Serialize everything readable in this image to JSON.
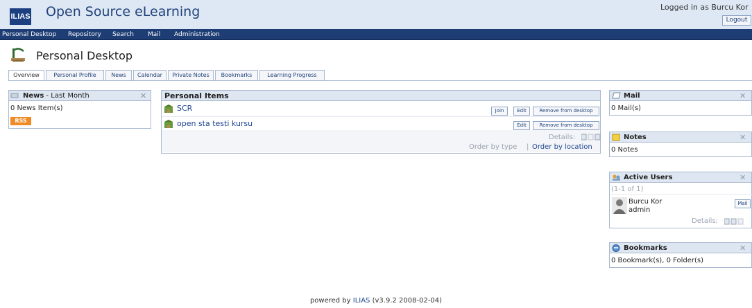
{
  "header": {
    "logo_text": "ILIAS",
    "app_title": "Open Source eLearning",
    "login_text": "Logged in as Burcu Kor",
    "logout_label": "Logout"
  },
  "mainmenu": {
    "items": [
      "Personal Desktop",
      "Repository",
      "Search",
      "Mail",
      "Administration"
    ]
  },
  "page": {
    "title": "Personal Desktop",
    "tabs": [
      "Overview",
      "Personal Profile",
      "News",
      "Calendar",
      "Private Notes",
      "Bookmarks",
      "Learning Progress"
    ],
    "active_tab": "Overview"
  },
  "news_block": {
    "title_bold": "News",
    "title_rest": " - Last Month",
    "count_text": "0 News Item(s)",
    "rss_label": "RSS"
  },
  "personal_items": {
    "title": "Personal Items",
    "items": [
      {
        "name": "SCR",
        "actions": [
          "Join",
          "Edit",
          "Remove from desktop"
        ]
      },
      {
        "name": "open sta testi kursu",
        "actions": [
          "Edit",
          "Remove from desktop"
        ]
      }
    ],
    "details_label": "Details:",
    "order_by_type": "Order by type",
    "separator": "|",
    "order_by_location": "Order by location"
  },
  "mail_block": {
    "title": "Mail",
    "text": "0 Mail(s)"
  },
  "notes_block": {
    "title": "Notes",
    "text": "0 Notes"
  },
  "users_block": {
    "title": "Active Users",
    "range": "(1-1 of 1)",
    "user_name": "Burcu Kor",
    "user_login": "admin",
    "mail_label": "Mail",
    "details_label": "Details:"
  },
  "bookmarks_block": {
    "title": "Bookmarks",
    "text": "0 Bookmark(s), 0 Folder(s)"
  },
  "footer": {
    "prefix": "powered by ",
    "link": "ILIAS",
    "version": " (v3.9.2 2008-02-04)"
  },
  "colors": {
    "header_bg": "#dde8f4",
    "menu_bg": "#1d3d74",
    "link": "#1f4590",
    "block_head": "#dde6f1",
    "rss": "#f08a24"
  }
}
